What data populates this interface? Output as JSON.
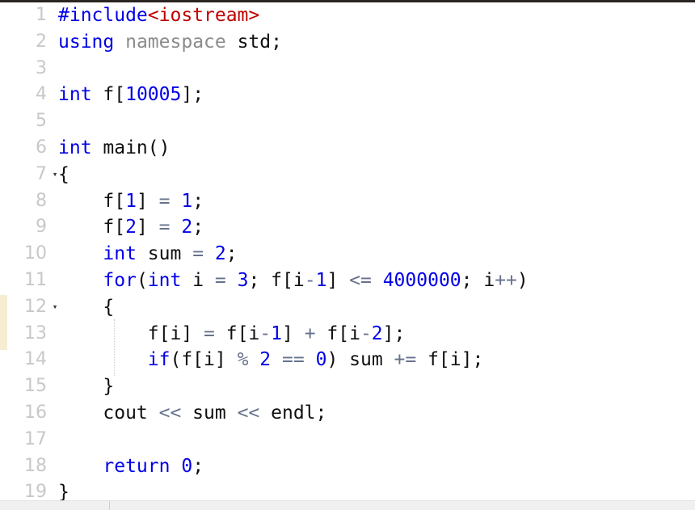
{
  "editor": {
    "language": "cpp",
    "background_color": "#ffffff",
    "gutter_color": "#c8c8c8",
    "keyword_color": "#0000e6",
    "number_color": "#0000e6",
    "header_color": "#c00000",
    "namespace_color": "#8c8c8c",
    "operator_color": "#66728c",
    "plain_color": "#101010",
    "change_marker_color": "#f6edd3",
    "total_lines": 19,
    "fold_marker_glyph": "▾",
    "change_marker_lines": [
      12,
      13
    ]
  },
  "scrollbar": {
    "orientation": "horizontal",
    "track_color": "#f0f0f0"
  },
  "lines": [
    {
      "number": "1",
      "fold": "",
      "tokens": [
        {
          "text": "#include",
          "type": "kw"
        },
        {
          "text": "<iostream>",
          "type": "hdr"
        }
      ]
    },
    {
      "number": "2",
      "fold": "",
      "tokens": [
        {
          "text": "using",
          "type": "kw"
        },
        {
          "text": " ",
          "type": "pl"
        },
        {
          "text": "namespace",
          "type": "ns"
        },
        {
          "text": " std;",
          "type": "pl"
        }
      ]
    },
    {
      "number": "3",
      "fold": "",
      "tokens": []
    },
    {
      "number": "4",
      "fold": "",
      "tokens": [
        {
          "text": "int",
          "type": "kw"
        },
        {
          "text": " f[",
          "type": "pl"
        },
        {
          "text": "10005",
          "type": "num"
        },
        {
          "text": "];",
          "type": "pl"
        }
      ]
    },
    {
      "number": "5",
      "fold": "",
      "tokens": []
    },
    {
      "number": "6",
      "fold": "",
      "tokens": [
        {
          "text": "int",
          "type": "kw"
        },
        {
          "text": " main()",
          "type": "pl"
        }
      ]
    },
    {
      "number": "7",
      "fold": "▾",
      "tokens": [
        {
          "text": "{",
          "type": "pl"
        }
      ]
    },
    {
      "number": "8",
      "fold": "",
      "tokens": [
        {
          "text": "    f[",
          "type": "pl"
        },
        {
          "text": "1",
          "type": "num"
        },
        {
          "text": "] ",
          "type": "pl"
        },
        {
          "text": "=",
          "type": "op"
        },
        {
          "text": " ",
          "type": "pl"
        },
        {
          "text": "1",
          "type": "num"
        },
        {
          "text": ";",
          "type": "pl"
        }
      ]
    },
    {
      "number": "9",
      "fold": "",
      "tokens": [
        {
          "text": "    f[",
          "type": "pl"
        },
        {
          "text": "2",
          "type": "num"
        },
        {
          "text": "] ",
          "type": "pl"
        },
        {
          "text": "=",
          "type": "op"
        },
        {
          "text": " ",
          "type": "pl"
        },
        {
          "text": "2",
          "type": "num"
        },
        {
          "text": ";",
          "type": "pl"
        }
      ]
    },
    {
      "number": "10",
      "fold": "",
      "tokens": [
        {
          "text": "    ",
          "type": "pl"
        },
        {
          "text": "int",
          "type": "kw"
        },
        {
          "text": " sum ",
          "type": "pl"
        },
        {
          "text": "=",
          "type": "op"
        },
        {
          "text": " ",
          "type": "pl"
        },
        {
          "text": "2",
          "type": "num"
        },
        {
          "text": ";",
          "type": "pl"
        }
      ]
    },
    {
      "number": "11",
      "fold": "",
      "tokens": [
        {
          "text": "    ",
          "type": "pl"
        },
        {
          "text": "for",
          "type": "kw"
        },
        {
          "text": "(",
          "type": "pl"
        },
        {
          "text": "int",
          "type": "kw"
        },
        {
          "text": " i ",
          "type": "pl"
        },
        {
          "text": "=",
          "type": "op"
        },
        {
          "text": " ",
          "type": "pl"
        },
        {
          "text": "3",
          "type": "num"
        },
        {
          "text": "; f[i",
          "type": "pl"
        },
        {
          "text": "-",
          "type": "op"
        },
        {
          "text": "1",
          "type": "num"
        },
        {
          "text": "] ",
          "type": "pl"
        },
        {
          "text": "<=",
          "type": "op"
        },
        {
          "text": " ",
          "type": "pl"
        },
        {
          "text": "4000000",
          "type": "num"
        },
        {
          "text": "; i",
          "type": "pl"
        },
        {
          "text": "++",
          "type": "op"
        },
        {
          "text": ")",
          "type": "pl"
        }
      ]
    },
    {
      "number": "12",
      "fold": "▾",
      "tokens": [
        {
          "text": "    {",
          "type": "pl"
        }
      ]
    },
    {
      "number": "13",
      "fold": "",
      "tokens": [
        {
          "text": "        f[i] ",
          "type": "pl"
        },
        {
          "text": "=",
          "type": "op"
        },
        {
          "text": " f[i",
          "type": "pl"
        },
        {
          "text": "-",
          "type": "op"
        },
        {
          "text": "1",
          "type": "num"
        },
        {
          "text": "] ",
          "type": "pl"
        },
        {
          "text": "+",
          "type": "op"
        },
        {
          "text": " f[i",
          "type": "pl"
        },
        {
          "text": "-",
          "type": "op"
        },
        {
          "text": "2",
          "type": "num"
        },
        {
          "text": "];",
          "type": "pl"
        }
      ]
    },
    {
      "number": "14",
      "fold": "",
      "tokens": [
        {
          "text": "        ",
          "type": "pl"
        },
        {
          "text": "if",
          "type": "kw"
        },
        {
          "text": "(f[i] ",
          "type": "pl"
        },
        {
          "text": "%",
          "type": "op"
        },
        {
          "text": " ",
          "type": "pl"
        },
        {
          "text": "2",
          "type": "num"
        },
        {
          "text": " ",
          "type": "pl"
        },
        {
          "text": "==",
          "type": "op"
        },
        {
          "text": " ",
          "type": "pl"
        },
        {
          "text": "0",
          "type": "num"
        },
        {
          "text": ") sum ",
          "type": "pl"
        },
        {
          "text": "+=",
          "type": "op"
        },
        {
          "text": " f[i];",
          "type": "pl"
        }
      ]
    },
    {
      "number": "15",
      "fold": "",
      "tokens": [
        {
          "text": "    }",
          "type": "pl"
        }
      ]
    },
    {
      "number": "16",
      "fold": "",
      "tokens": [
        {
          "text": "    cout ",
          "type": "pl"
        },
        {
          "text": "<<",
          "type": "op"
        },
        {
          "text": " sum ",
          "type": "pl"
        },
        {
          "text": "<<",
          "type": "op"
        },
        {
          "text": " endl;",
          "type": "pl"
        }
      ]
    },
    {
      "number": "17",
      "fold": "",
      "tokens": []
    },
    {
      "number": "18",
      "fold": "",
      "tokens": [
        {
          "text": "    ",
          "type": "pl"
        },
        {
          "text": "return",
          "type": "kw"
        },
        {
          "text": " ",
          "type": "pl"
        },
        {
          "text": "0",
          "type": "num"
        },
        {
          "text": ";",
          "type": "pl"
        }
      ]
    },
    {
      "number": "19",
      "fold": "",
      "tokens": [
        {
          "text": "}",
          "type": "pl"
        }
      ]
    }
  ],
  "source_code": "#include<iostream>\nusing namespace std;\n\nint f[10005];\n\nint main()\n{\n    f[1] = 1;\n    f[2] = 2;\n    int sum = 2;\n    for(int i = 3; f[i-1] <= 4000000; i++)\n    {\n        f[i] = f[i-1] + f[i-2];\n        if(f[i] % 2 == 0) sum += f[i];\n    }\n    cout << sum << endl;\n\n    return 0;\n}"
}
